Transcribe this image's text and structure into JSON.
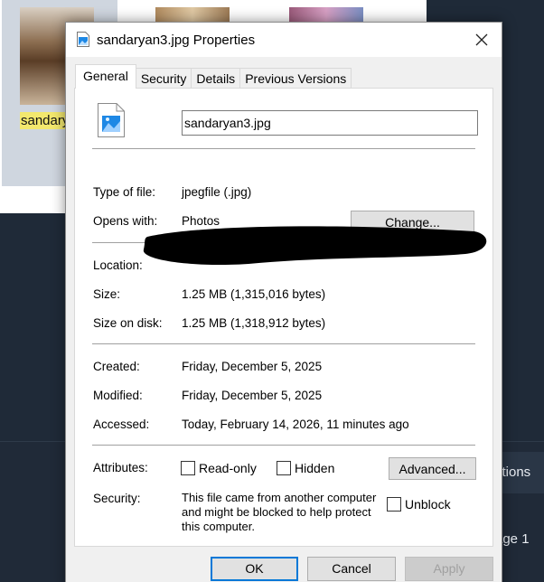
{
  "background": {
    "thumbnail_label": "sandary",
    "right_button_text": "ctions",
    "page_text": "age 1"
  },
  "dialog": {
    "title": "sandaryan3.jpg Properties",
    "tabs": [
      {
        "label": "General",
        "active": true
      },
      {
        "label": "Security",
        "active": false
      },
      {
        "label": "Details",
        "active": false
      },
      {
        "label": "Previous Versions",
        "active": false
      }
    ],
    "file_name": "sandaryan3.jpg",
    "type_of_file": {
      "label": "Type of file:",
      "value": "jpegfile (.jpg)"
    },
    "opens_with": {
      "label": "Opens with:",
      "value": "Photos",
      "change_button": "Change..."
    },
    "location": {
      "label": "Location:"
    },
    "size": {
      "label": "Size:",
      "value": "1.25 MB (1,315,016 bytes)"
    },
    "size_on_disk": {
      "label": "Size on disk:",
      "value": "1.25 MB (1,318,912 bytes)"
    },
    "created": {
      "label": "Created:",
      "value": "Friday, December 5, 2025"
    },
    "modified": {
      "label": "Modified:",
      "value": "Friday, December 5, 2025"
    },
    "accessed": {
      "label": "Accessed:",
      "value": "Today, February 14, 2026, 11 minutes ago"
    },
    "attributes": {
      "label": "Attributes:",
      "read_only": "Read-only",
      "hidden": "Hidden",
      "advanced_button": "Advanced..."
    },
    "security": {
      "label": "Security:",
      "text": "This file came from another computer and might be blocked to help protect this computer.",
      "unblock": "Unblock"
    },
    "buttons": {
      "ok": "OK",
      "cancel": "Cancel",
      "apply": "Apply"
    },
    "colors": {
      "accent": "#0078d7",
      "icon_blue": "#1e88e5"
    }
  }
}
